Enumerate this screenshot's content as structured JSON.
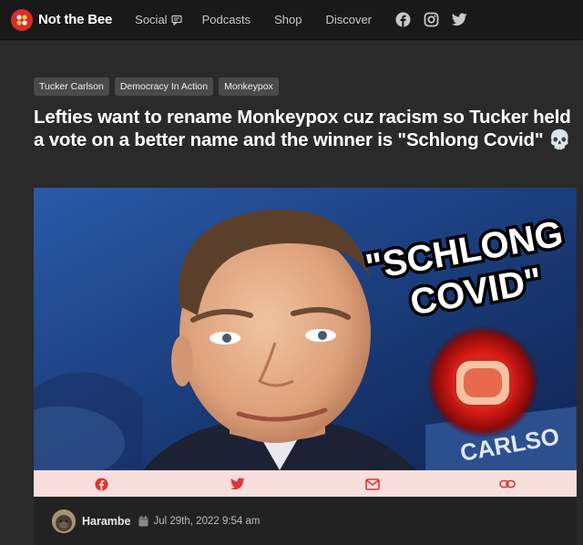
{
  "site": {
    "name": "Not the Bee"
  },
  "nav": {
    "items": [
      {
        "label": "Social"
      },
      {
        "label": "Podcasts"
      },
      {
        "label": "Shop"
      },
      {
        "label": "Discover"
      }
    ],
    "social_icons": [
      "facebook-icon",
      "instagram-icon",
      "twitter-icon"
    ]
  },
  "article": {
    "tags": [
      "Tucker Carlson",
      "Democracy In Action",
      "Monkeypox"
    ],
    "title": "Lefties want to rename Monkeypox cuz racism so Tucker held a vote on a better name and the winner is \"Schlong Covid\" 💀",
    "image": {
      "overlay_line1": "\"SCHLONG",
      "overlay_line2": "COVID\"",
      "background_text": "CARLSO"
    },
    "share": [
      "facebook-icon",
      "twitter-icon",
      "envelope-icon",
      "link-icon"
    ],
    "author": "Harambe",
    "date": "Jul 29th, 2022 9:54 am"
  },
  "colors": {
    "brand_red": "#d92b2b",
    "share_bar": "#f9dede",
    "share_icon": "#e03535",
    "background": "#2a2a2a"
  }
}
